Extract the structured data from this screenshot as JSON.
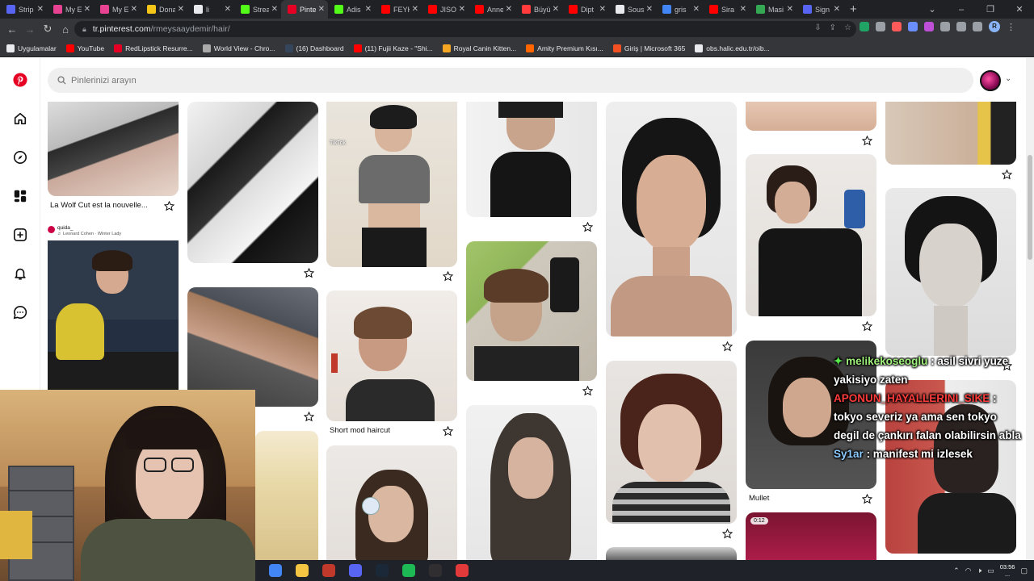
{
  "browser": {
    "tabs": [
      {
        "label": "Strip",
        "color": "#5865f2",
        "active": false
      },
      {
        "label": "My E",
        "color": "#e84393",
        "active": false
      },
      {
        "label": "My E",
        "color": "#e84393",
        "active": false
      },
      {
        "label": "Dona",
        "color": "#f5c518",
        "active": false
      },
      {
        "label": "li",
        "color": "#e8eaed",
        "active": false
      },
      {
        "label": "Strea",
        "color": "#53fc18",
        "active": false
      },
      {
        "label": "Pinte",
        "color": "#e60023",
        "active": true
      },
      {
        "label": "Adis",
        "color": "#53fc18",
        "active": false
      },
      {
        "label": "FEYK",
        "color": "#ff0000",
        "active": false
      },
      {
        "label": "JISO",
        "color": "#ff0000",
        "active": false
      },
      {
        "label": "Anne",
        "color": "#ff0000",
        "active": false
      },
      {
        "label": "Büyü",
        "color": "#ff3b3b",
        "active": false
      },
      {
        "label": "Dipt",
        "color": "#ff0000",
        "active": false
      },
      {
        "label": "Sous",
        "color": "#e8eaed",
        "active": false
      },
      {
        "label": "gris",
        "color": "#4285f4",
        "active": false
      },
      {
        "label": "Sira",
        "color": "#ff0000",
        "active": false
      },
      {
        "label": "Masi",
        "color": "#34a853",
        "active": false
      },
      {
        "label": "Sign",
        "color": "#5865f2",
        "active": false
      }
    ],
    "new_tab_glyph": "+",
    "window_controls": [
      "⌄",
      "–",
      "❐",
      "✕"
    ],
    "url_host": "tr.pinterest.com",
    "url_path": "/rmeysaaydemir/hair/",
    "profile_initial": "R",
    "bookmarks": [
      {
        "label": "Uygulamalar",
        "color": "#e8eaed"
      },
      {
        "label": "YouTube",
        "color": "#ff0000"
      },
      {
        "label": "RedLipstick Resurre...",
        "color": "#e60023"
      },
      {
        "label": "World View - Chro...",
        "color": "#aaaaaa"
      },
      {
        "label": "(16) Dashboard",
        "color": "#35465c"
      },
      {
        "label": "(11) Fujii Kaze - \"Shi...",
        "color": "#ff0000"
      },
      {
        "label": "Royal Canin Kitten...",
        "color": "#f5a623"
      },
      {
        "label": "Amity Premium Kısı...",
        "color": "#ff6600"
      },
      {
        "label": "Giriş | Microsoft 365",
        "color": "#f25022"
      },
      {
        "label": "obs.halic.edu.tr/oib...",
        "color": "#e8eaed"
      }
    ]
  },
  "pinterest": {
    "brand_color": "#e60023",
    "search_placeholder": "Pinlerinizi arayın",
    "rail_icons": [
      "pinterest-logo-icon",
      "home-icon",
      "explore-icon",
      "boards-icon",
      "create-icon",
      "notifications-icon",
      "messages-icon"
    ],
    "captions": {
      "wolf_cut": "La Wolf Cut est la nouvelle...",
      "short_mod": "Short mod haircut",
      "mullet": "Mullet",
      "embed_user": "quida_",
      "embed_sub": "♬ Leonard Cohen · Winter Lady",
      "tiktok": "TikTok",
      "video_badge": "0:12"
    }
  },
  "chat": [
    {
      "user": "melikekoseoglu",
      "message": ": asil sivri yuze yakisiyo zaten"
    },
    {
      "user": "APONUN_HAYALLERINI_SIKE",
      "message": ": tokyo severiz ya ama sen tokyo degil de çankırı falan olabilirsin abla"
    },
    {
      "user": "Sy1ar",
      "message": ": manifest mi izlesek"
    }
  ],
  "taskbar": {
    "icons": [
      {
        "name": "chrome",
        "color": "#4285f4"
      },
      {
        "name": "file-explorer",
        "color": "#f4c542"
      },
      {
        "name": "video-recorder",
        "color": "#c0392b"
      },
      {
        "name": "discord",
        "color": "#5865f2"
      },
      {
        "name": "steam",
        "color": "#1b2838"
      },
      {
        "name": "spotify",
        "color": "#1db954"
      },
      {
        "name": "obs",
        "color": "#302e31"
      },
      {
        "name": "app",
        "color": "#e23a3a"
      }
    ],
    "time": "03:56",
    "date": "..."
  }
}
